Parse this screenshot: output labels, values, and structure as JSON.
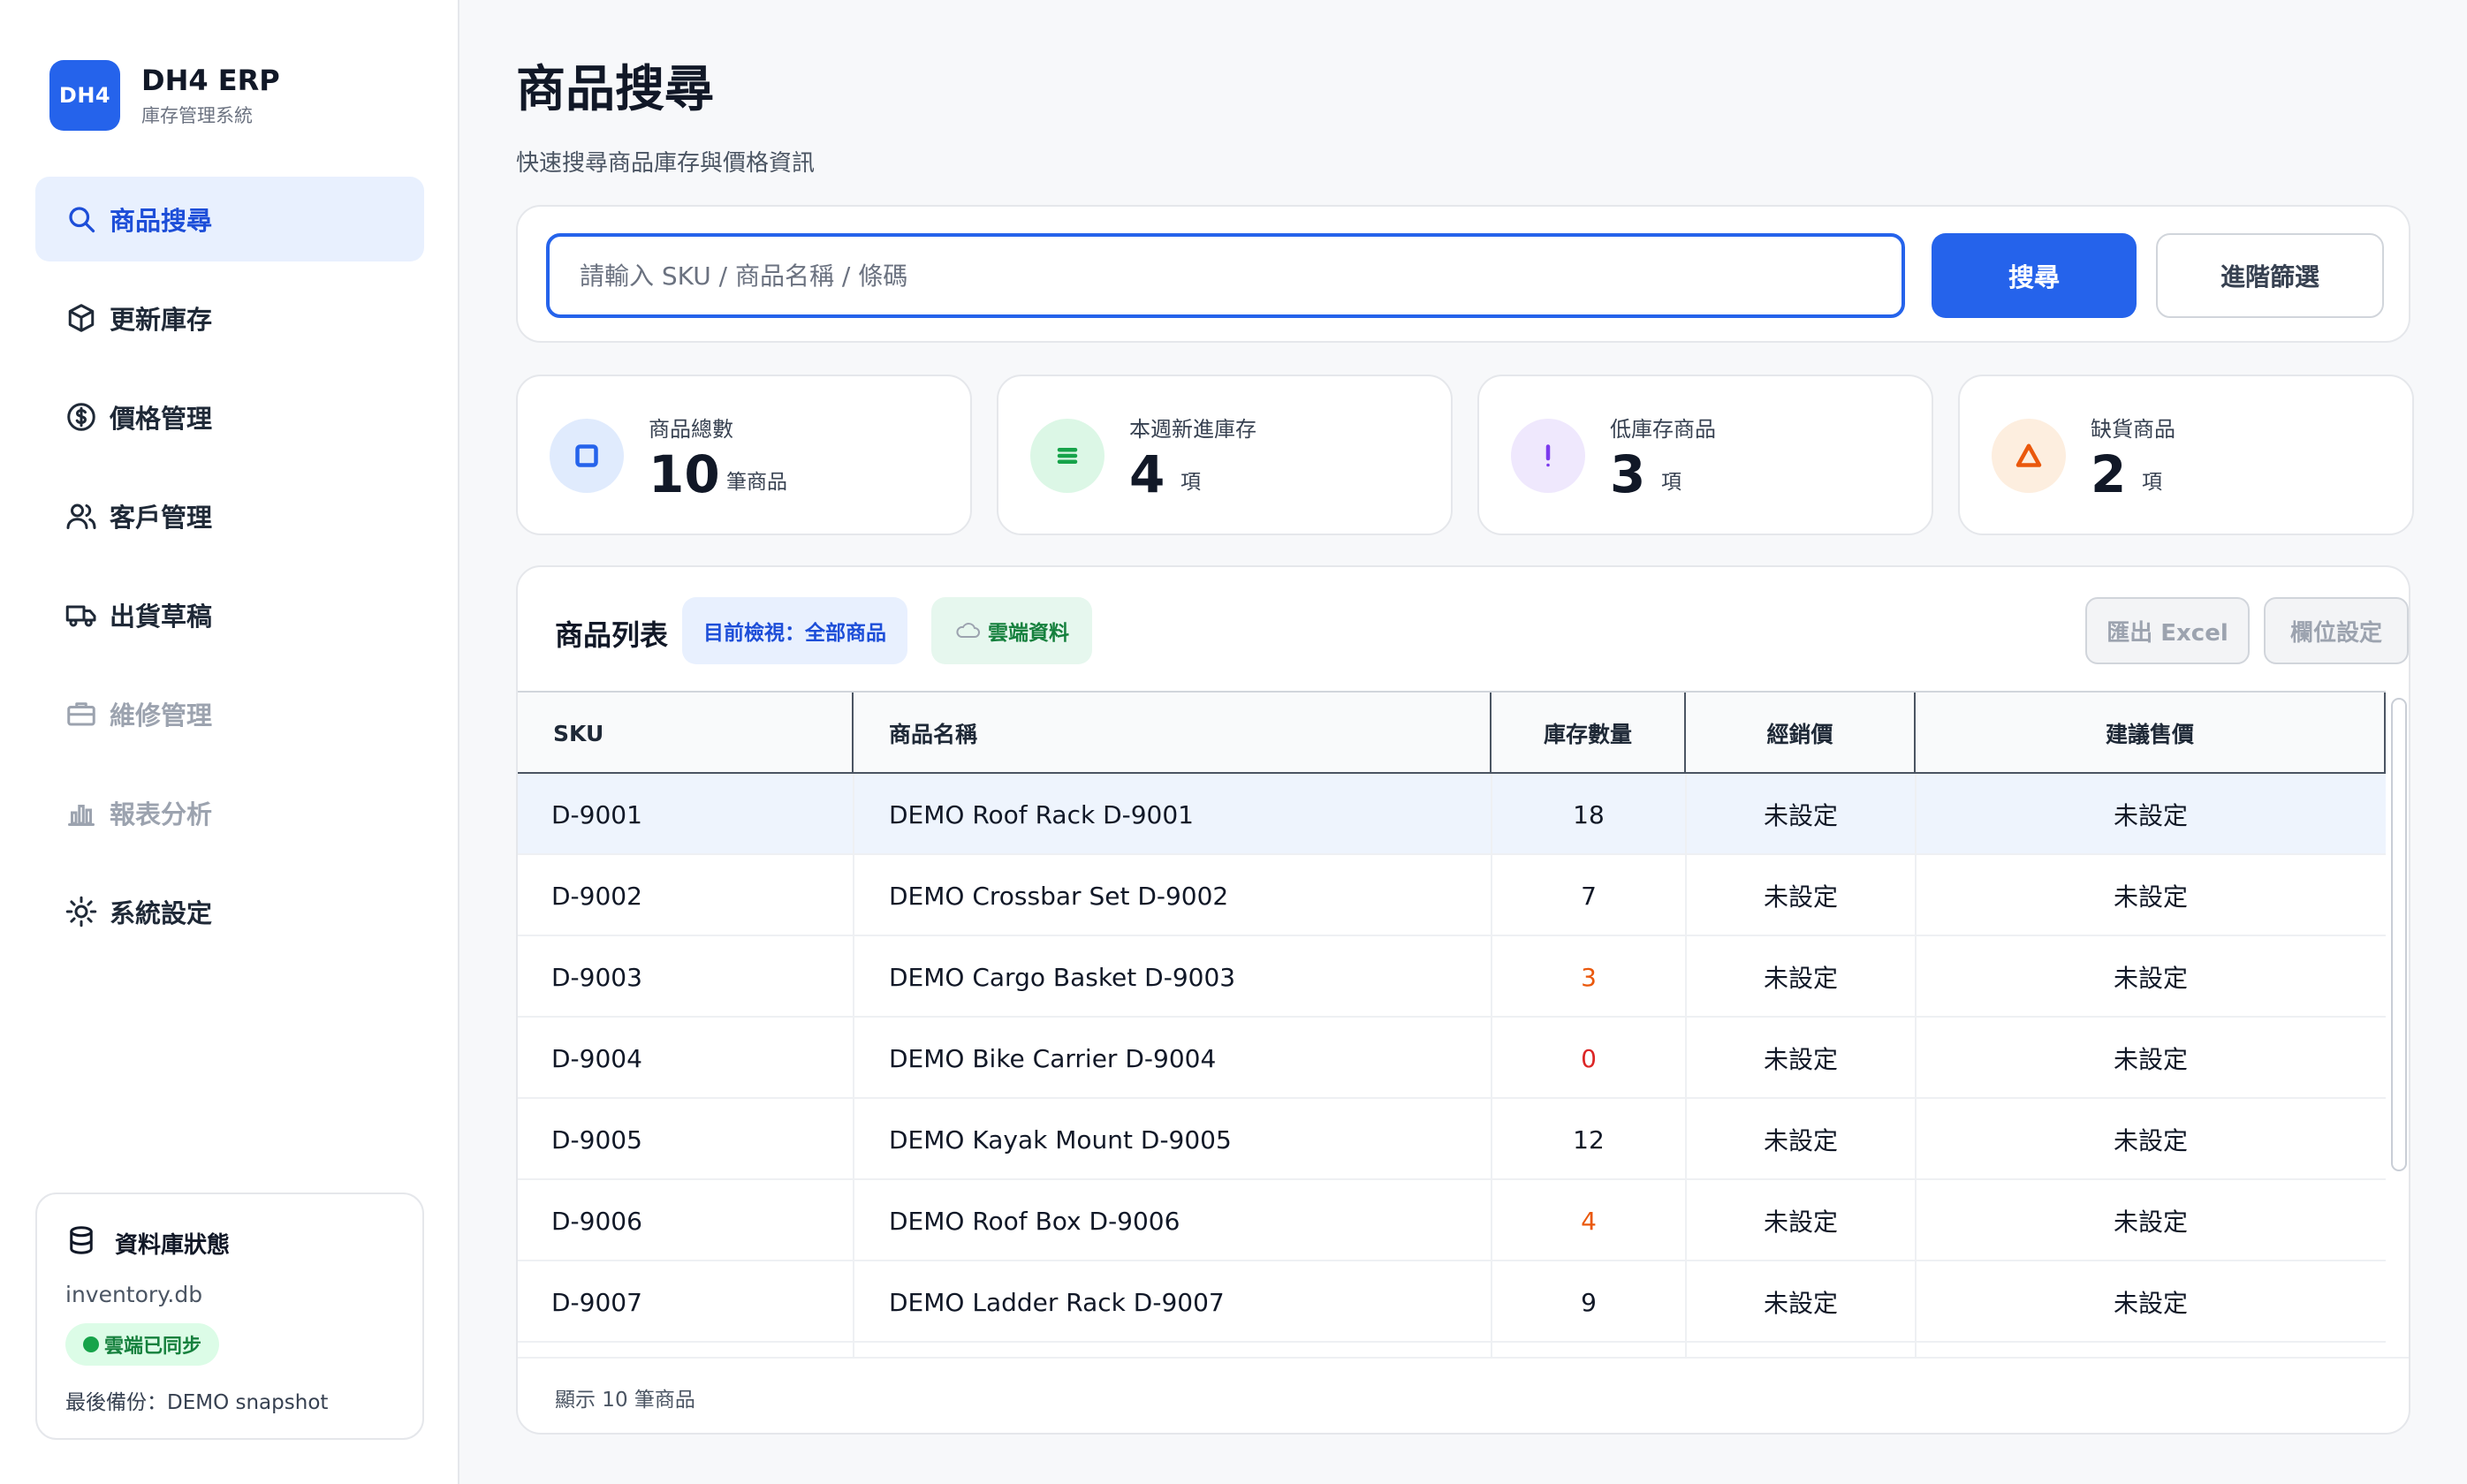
{
  "brand": {
    "logo": "DH4",
    "name": "DH4 ERP",
    "subtitle": "庫存管理系統"
  },
  "sidebar": {
    "items": [
      {
        "label": "商品搜尋",
        "icon": "search-icon",
        "state": "active"
      },
      {
        "label": "更新庫存",
        "icon": "box-icon",
        "state": "normal"
      },
      {
        "label": "價格管理",
        "icon": "dollar-circle-icon",
        "state": "normal"
      },
      {
        "label": "客戶管理",
        "icon": "users-icon",
        "state": "normal"
      },
      {
        "label": "出貨草稿",
        "icon": "truck-icon",
        "state": "normal"
      },
      {
        "label": "維修管理",
        "icon": "briefcase-icon",
        "state": "disabled"
      },
      {
        "label": "報表分析",
        "icon": "bar-chart-icon",
        "state": "disabled"
      },
      {
        "label": "系統設定",
        "icon": "sun-gear-icon",
        "state": "normal"
      }
    ]
  },
  "db_status": {
    "title": "資料庫狀態",
    "file": "inventory.db",
    "sync_label": "雲端已同步",
    "backup": "最後備份：DEMO snapshot"
  },
  "page": {
    "title": "商品搜尋",
    "subtitle": "快速搜尋商品庫存與價格資訊"
  },
  "search": {
    "placeholder": "請輸入 SKU / 商品名稱 / 條碼",
    "value": "",
    "search_button": "搜尋",
    "advanced_button": "進階篩選"
  },
  "stats": [
    {
      "label": "商品總數",
      "value": "10",
      "unit": "筆商品",
      "icon": "square-icon",
      "color": "#2563eb",
      "bg": "#e0ebfd"
    },
    {
      "label": "本週新進庫存",
      "value": "4",
      "unit": "項",
      "icon": "list-icon",
      "color": "#16a34a",
      "bg": "#dcf7e6"
    },
    {
      "label": "低庫存商品",
      "value": "3",
      "unit": "項",
      "icon": "exclamation-icon",
      "color": "#7c3aed",
      "bg": "#efe8fd"
    },
    {
      "label": "缺貨商品",
      "value": "2",
      "unit": "項",
      "icon": "warning-triangle-icon",
      "color": "#ea580c",
      "bg": "#fdeedf"
    }
  ],
  "table": {
    "title": "商品列表",
    "view_tag": "目前檢視：全部商品",
    "cloud_tag": "雲端資料",
    "export_button": "匯出 Excel",
    "columns_button": "欄位設定",
    "columns": [
      "SKU",
      "商品名稱",
      "庫存數量",
      "經銷價",
      "建議售價"
    ],
    "rows": [
      {
        "sku": "D-9001",
        "name": "DEMO Roof Rack D-9001",
        "qty": "18",
        "qty_color": "#111827",
        "dealer": "未設定",
        "retail": "未設定"
      },
      {
        "sku": "D-9002",
        "name": "DEMO Crossbar Set D-9002",
        "qty": "7",
        "qty_color": "#111827",
        "dealer": "未設定",
        "retail": "未設定"
      },
      {
        "sku": "D-9003",
        "name": "DEMO Cargo Basket D-9003",
        "qty": "3",
        "qty_color": "#ea580c",
        "dealer": "未設定",
        "retail": "未設定"
      },
      {
        "sku": "D-9004",
        "name": "DEMO Bike Carrier D-9004",
        "qty": "0",
        "qty_color": "#dc2626",
        "dealer": "未設定",
        "retail": "未設定"
      },
      {
        "sku": "D-9005",
        "name": "DEMO Kayak Mount D-9005",
        "qty": "12",
        "qty_color": "#111827",
        "dealer": "未設定",
        "retail": "未設定"
      },
      {
        "sku": "D-9006",
        "name": "DEMO Roof Box D-9006",
        "qty": "4",
        "qty_color": "#ea580c",
        "dealer": "未設定",
        "retail": "未設定"
      },
      {
        "sku": "D-9007",
        "name": "DEMO Ladder Rack D-9007",
        "qty": "9",
        "qty_color": "#111827",
        "dealer": "未設定",
        "retail": "未設定"
      }
    ],
    "footer": "顯示 10 筆商品"
  }
}
